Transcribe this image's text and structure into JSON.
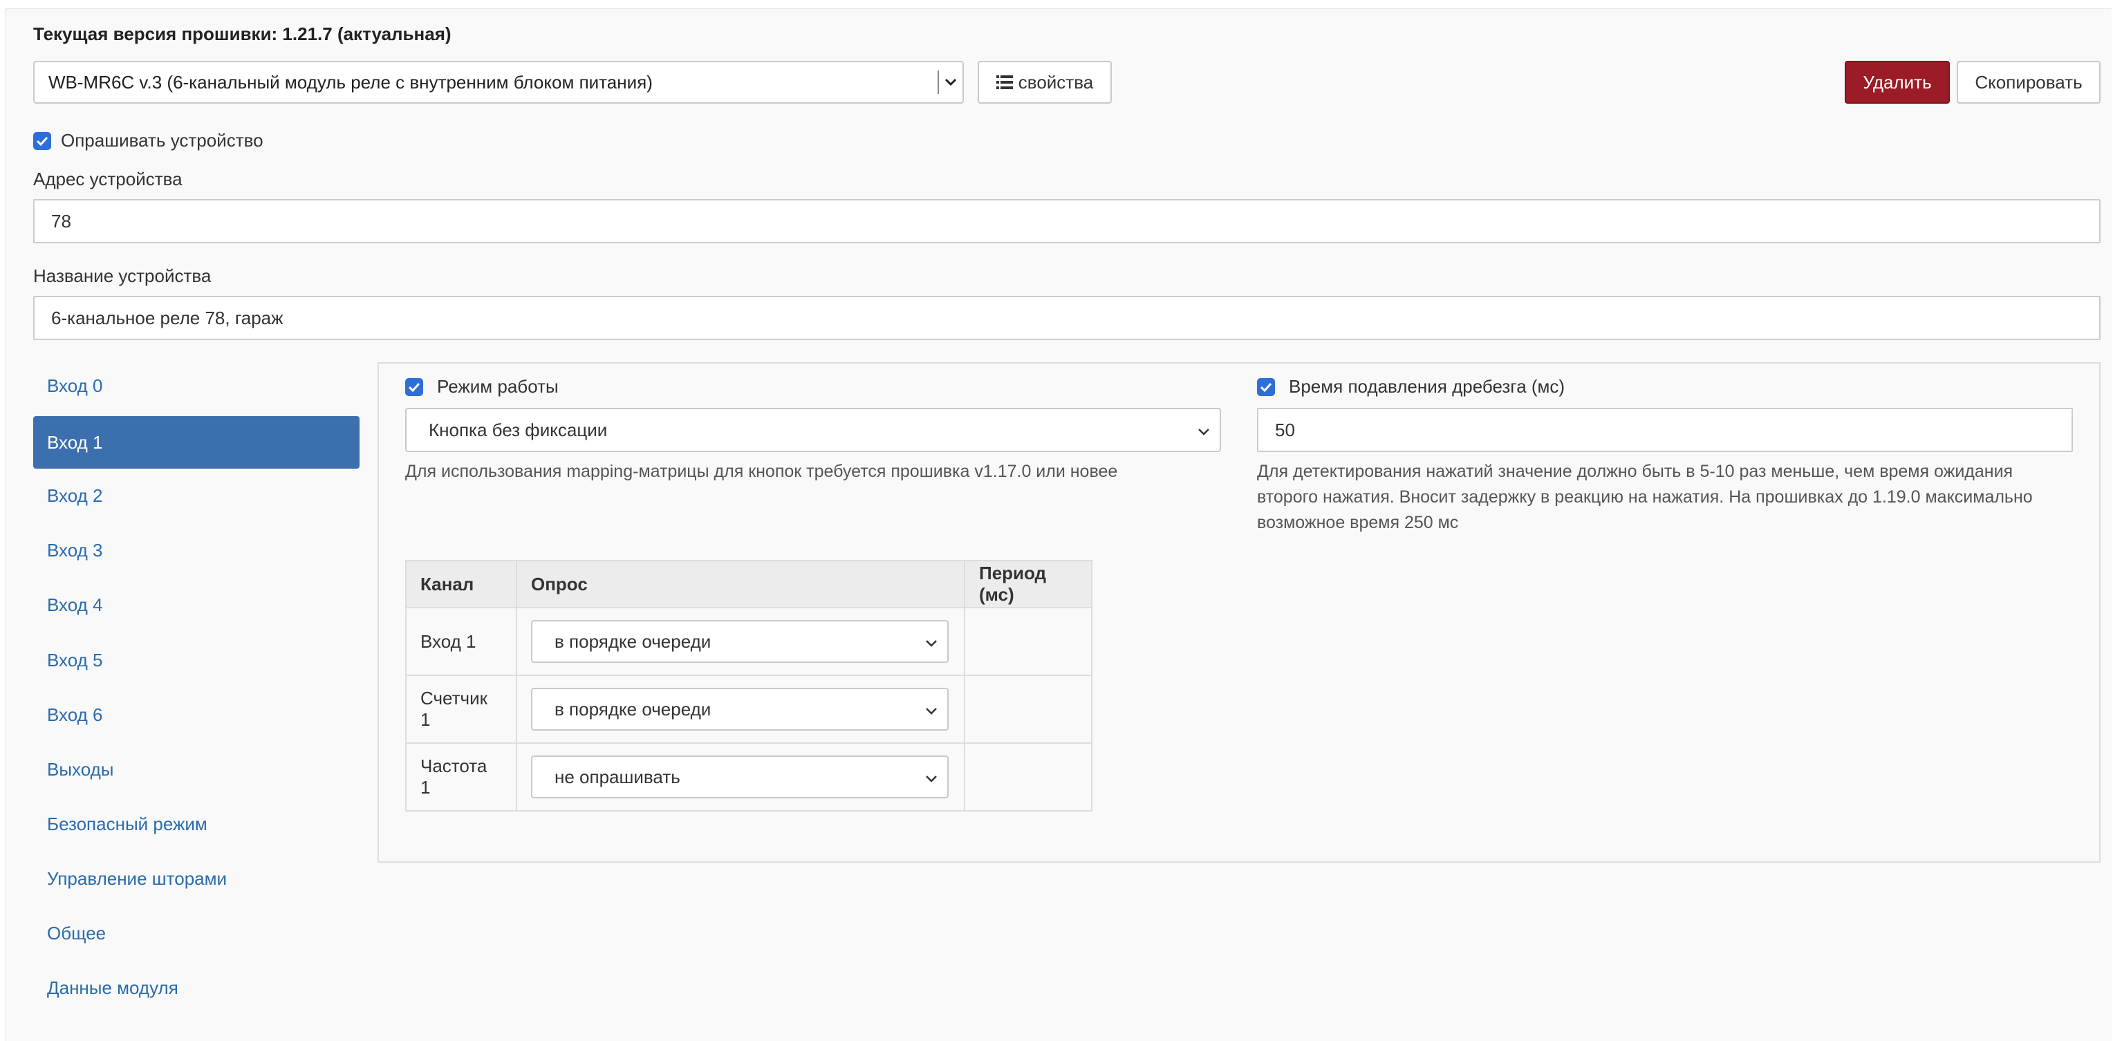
{
  "firmware": {
    "label": "Текущая версия прошивки: 1.21.7 (актуальная)"
  },
  "device_select": {
    "value": "WB-MR6C v.3 (6-канальный модуль реле с внутренним блоком питания)"
  },
  "toolbar": {
    "properties_label": "свойства",
    "delete_label": "Удалить",
    "copy_label": "Скопировать"
  },
  "poll_device": {
    "label": "Опрашивать устройство",
    "checked": true
  },
  "address": {
    "label": "Адрес устройства",
    "value": "78"
  },
  "name": {
    "label": "Название устройства",
    "value": "6-канальное реле 78, гараж"
  },
  "nav": {
    "items": [
      {
        "label": "Вход 0"
      },
      {
        "label": "Вход 1",
        "active": true
      },
      {
        "label": "Вход 2"
      },
      {
        "label": "Вход 3"
      },
      {
        "label": "Вход 4"
      },
      {
        "label": "Вход 5"
      },
      {
        "label": "Вход 6"
      },
      {
        "label": "Выходы"
      },
      {
        "label": "Безопасный режим"
      },
      {
        "label": "Управление шторами"
      },
      {
        "label": "Общее"
      },
      {
        "label": "Данные модуля"
      }
    ]
  },
  "mode": {
    "label": "Режим работы",
    "value": "Кнопка без фиксации",
    "help": "Для использования mapping-матрицы для кнопок требуется прошивка v1.17.0 или новее"
  },
  "debounce": {
    "label": "Время подавления дребезга (мс)",
    "value": "50",
    "help": [
      "Для детектирования нажатий значение должно быть в 5-10 раз меньше, чем время ожидания",
      "второго нажатия. Вносит задержку в реакцию на нажатия. На прошивках до 1.19.0 максимально",
      "возможное время 250 мс"
    ]
  },
  "channels": {
    "headers": [
      "Канал",
      "Опрос",
      "Период (мс)"
    ],
    "rows": [
      {
        "channel": "Вход 1",
        "poll": "в порядке очереди",
        "period": ""
      },
      {
        "channel": "Счетчик 1",
        "poll": "в порядке очереди",
        "period": ""
      },
      {
        "channel": "Частота 1",
        "poll": "не опрашивать",
        "period": ""
      }
    ]
  },
  "colors": {
    "accent": "#3c6fad",
    "link": "#2a6bad",
    "danger": "#9b1b26",
    "checkbox": "#2d6fd6"
  }
}
